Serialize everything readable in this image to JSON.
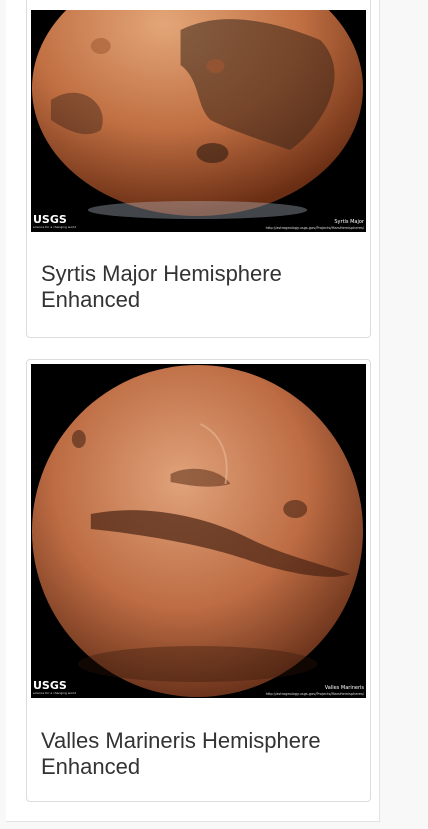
{
  "cards": [
    {
      "title": "Syrtis Major Hemisphere Enhanced",
      "logo_text": "USGS",
      "logo_tagline": "science for a changing world",
      "image_caption": "Syrtis Major",
      "image_url_text": "http://astrogeology.usgs.gov/Projects/MarsHemispheres/"
    },
    {
      "title": "Valles Marineris Hemisphere Enhanced",
      "logo_text": "USGS",
      "logo_tagline": "science for a changing world",
      "image_caption": "Valles Marineris",
      "image_url_text": "http://astrogeology.usgs.gov/Projects/MarsHemispheres/"
    }
  ],
  "colors": {
    "mars_light": "#d89a6e",
    "mars_mid": "#b5643a",
    "mars_dark": "#5a2a14",
    "image_background": "#000000",
    "title_text": "#333333"
  }
}
